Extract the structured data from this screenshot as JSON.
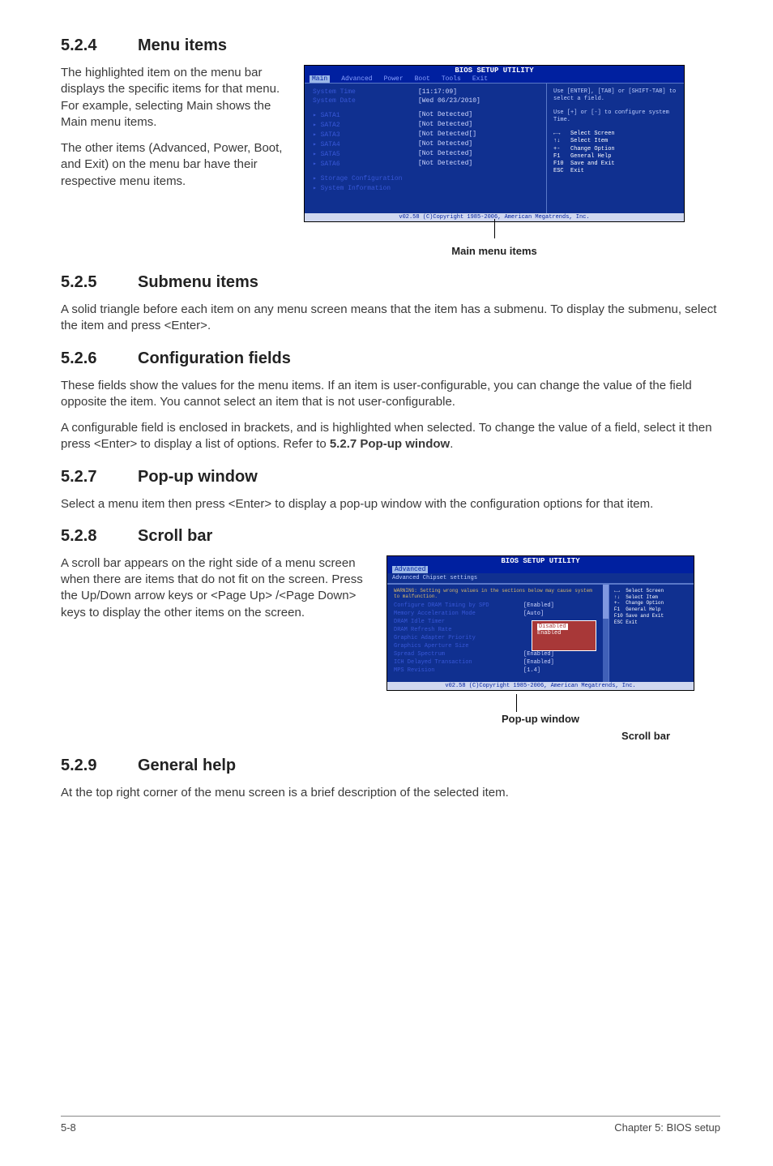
{
  "sections": {
    "s524": {
      "num": "5.2.4",
      "title": "Menu items",
      "p1": "The highlighted item on the menu bar displays the specific items for that menu. For example, selecting Main shows the Main menu items.",
      "p2": "The other items (Advanced, Power, Boot, and Exit) on the menu bar have their respective menu items.",
      "caption": "Main menu items"
    },
    "s525": {
      "num": "5.2.5",
      "title": "Submenu items",
      "p1": "A solid triangle before each item on any menu screen means that the item has a submenu. To display the submenu, select the item and press <Enter>."
    },
    "s526": {
      "num": "5.2.6",
      "title": "Configuration fields",
      "p1": "These fields show the values for the menu items. If an item is user-configurable, you can change the value of the field opposite the item. You cannot select an item that is not user-configurable.",
      "p2a": "A configurable field is enclosed in brackets, and is highlighted when selected. To change the value of a field, select it then press <Enter> to display a list of options. Refer to ",
      "p2b": "5.2.7 Pop-up window",
      "p2c": "."
    },
    "s527": {
      "num": "5.2.7",
      "title": "Pop-up window",
      "p1": "Select a menu item then press <Enter> to display a pop-up window with the configuration options for that item."
    },
    "s528": {
      "num": "5.2.8",
      "title": "Scroll bar",
      "p1": "A scroll bar appears on the right side of a menu screen when there are items that do not fit on the screen. Press the Up/Down arrow keys or <Page Up> /<Page Down> keys to display the other items on the screen.",
      "caption1": "Pop-up window",
      "caption2": "Scroll bar"
    },
    "s529": {
      "num": "5.2.9",
      "title": "General help",
      "p1": "At the top right corner of the menu screen is a brief description of the selected item."
    }
  },
  "bios1": {
    "title": "BIOS SETUP UTILITY",
    "tabs": [
      "Main",
      "Advanced",
      "Power",
      "Boot",
      "Tools",
      "Exit"
    ],
    "rows": [
      {
        "lbl": "System Time",
        "val": "[11:17:09]"
      },
      {
        "lbl": "System Date",
        "val": "[Wed 06/23/2010]"
      }
    ],
    "sata": [
      {
        "lbl": "SATA1",
        "val": "[Not Detected]"
      },
      {
        "lbl": "SATA2",
        "val": "[Not Detected]"
      },
      {
        "lbl": "SATA3",
        "val": "[Not Detected[]"
      },
      {
        "lbl": "SATA4",
        "val": "[Not Detected]"
      },
      {
        "lbl": "SATA5",
        "val": "[Not Detected]"
      },
      {
        "lbl": "SATA6",
        "val": "[Not Detected]"
      }
    ],
    "sub": [
      "Storage Configuration",
      "System Information"
    ],
    "help1": "Use [ENTER], [TAB] or [SHIFT-TAB] to select a field.",
    "help2": "Use [+] or [-] to configure system Time.",
    "keys": "←→   Select Screen\n↑↓   Select Item\n+-   Change Option\nF1   General Help\nF10  Save and Exit\nESC  Exit",
    "foot": "v02.58 (C)Copyright 1985-2006, American Megatrends, Inc."
  },
  "bios2": {
    "title": "BIOS SETUP UTILITY",
    "tab": "Advanced",
    "subtitle": "Advanced Chipset settings",
    "warn": "WARNING: Setting wrong values in the sections below may cause system to malfunction.",
    "rows": [
      {
        "lbl": "Configure DRAM Timing by SPD",
        "val": "[Enabled]"
      },
      {
        "lbl": "Memory Acceleration Mode",
        "val": "[Auto]"
      },
      {
        "lbl": "DRAM Idle Timer",
        "val": ""
      },
      {
        "lbl": "DRAM Refresh Rate",
        "val": ""
      },
      {
        "lbl": "Graphic Adapter Priority",
        "val": ""
      },
      {
        "lbl": "Graphics Aperture Size",
        "val": ""
      },
      {
        "lbl": "Spread Spectrum",
        "val": "[Enabled]"
      },
      {
        "lbl": "ICH Delayed Transaction",
        "val": "[Enabled]"
      },
      {
        "lbl": "MPS Revision",
        "val": "[1.4]"
      }
    ],
    "popup": [
      "Disabled",
      "Enabled"
    ],
    "keys": "←→  Select Screen\n↑↓  Select Item\n+-  Change Option\nF1  General Help\nF10 Save and Exit\nESC Exit",
    "foot": "v02.58 (C)Copyright 1985-2006, American Megatrends, Inc."
  },
  "footer": {
    "left": "5-8",
    "right": "Chapter 5: BIOS setup"
  }
}
